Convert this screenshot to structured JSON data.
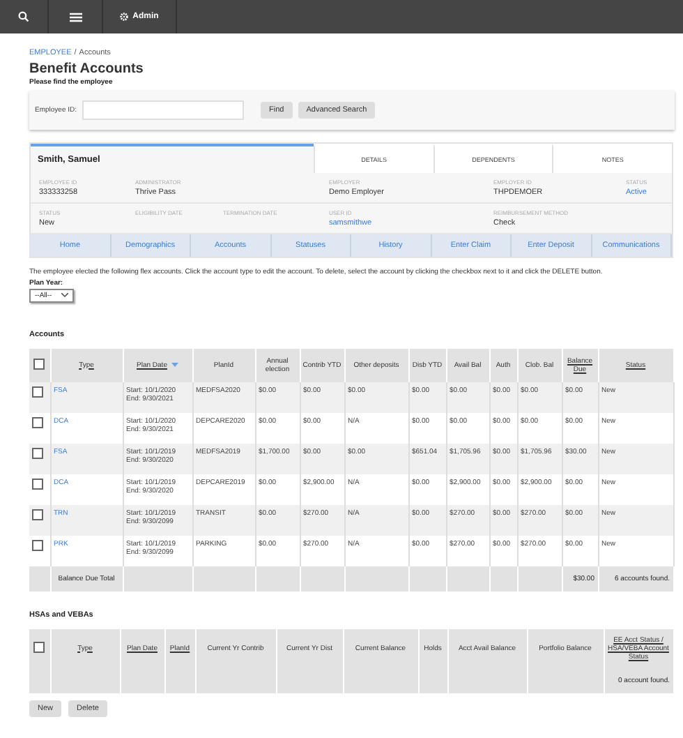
{
  "topbar": {
    "admin_label": "Admin"
  },
  "breadcrumb": {
    "link": "EMPLOYEE",
    "separator": "/",
    "current": "Accounts"
  },
  "title": "Benefit Accounts",
  "subtitle": "Please find the employee",
  "search": {
    "label": "Employee ID:",
    "buttons": [
      "Find",
      "Advanced Search"
    ]
  },
  "employee": {
    "name": "Smith, Samuel",
    "tabs": [
      {
        "label": "DETAILS",
        "selected": false
      },
      {
        "label": "DEPENDENTS",
        "selected": false
      },
      {
        "label": "NOTES",
        "selected": false
      }
    ],
    "fields_row_1": [
      {
        "label": "EMPLOYEE ID",
        "value": "333333258",
        "link": false
      },
      {
        "label": "ADMINISTRATOR",
        "value": "Thrive Pass",
        "link": false
      },
      {
        "label": "EMPLOYER",
        "value": "Demo Employer",
        "link": false
      },
      {
        "label": "EMPLOYER ID",
        "value": "THPDEMOER",
        "link": false
      },
      {
        "label": "STATUS",
        "value": "Active",
        "link": true
      }
    ],
    "fields_row_2": [
      {
        "label": "STATUS",
        "value": "New",
        "link": false
      },
      {
        "label": "ELIGIBILITY DATE"
      },
      {
        "label": "TERMINATION DATE"
      },
      {
        "label": "USER ID",
        "value": "samsmithwe",
        "link": true
      },
      {
        "label": "REIMBURSEMENT METHOD",
        "value": "Check",
        "link": false
      }
    ],
    "nav": [
      {
        "label": "Home",
        "selected": false
      },
      {
        "label": "Demographics",
        "selected": false
      },
      {
        "label": "Accounts",
        "selected": false
      },
      {
        "label": "Statuses",
        "selected": false
      },
      {
        "label": "History",
        "selected": false
      },
      {
        "label": "Enter Claim",
        "selected": false
      },
      {
        "label": "Enter Deposit",
        "selected": false
      },
      {
        "label": "Communications",
        "selected": false
      }
    ]
  },
  "instructions": "The employee elected the following flex accounts. Click the account type to edit the account. To delete, select the account by clicking the checkbox next to it and click the DELETE button.",
  "plan_year": {
    "label": "Plan Year:",
    "value": "--All--"
  },
  "accounts": {
    "title": "Accounts",
    "header_checked": false,
    "columns": [
      {
        "label": "Type",
        "link": true
      },
      {
        "label": "Plan Date",
        "link": true,
        "sorted": true
      },
      {
        "label": "PlanId",
        "link": false
      },
      {
        "label": "Annual election",
        "link": false
      },
      {
        "label": "Contrib YTD",
        "link": false
      },
      {
        "label": "Other deposits",
        "link": false
      },
      {
        "label": "Disb YTD",
        "link": false
      },
      {
        "label": "Avail Bal",
        "link": false
      },
      {
        "label": "Auth",
        "link": false
      },
      {
        "label": "Clob. Bal",
        "link": false
      },
      {
        "label": "Balance Due",
        "link": true
      },
      {
        "label": "Status",
        "link": true
      }
    ],
    "rows": [
      {
        "checked": false,
        "cells": [
          "FSA",
          "Start: 10/1/2020\nEnd: 9/30/2021",
          "MEDFSA2020",
          "$0.00",
          "$0.00",
          "$0.00",
          "$0.00",
          "$0.00",
          "$0.00",
          "$0.00",
          "$0.00",
          "New"
        ]
      },
      {
        "checked": false,
        "cells": [
          "DCA",
          "Start: 10/1/2020\nEnd: 9/30/2021",
          "DEPCARE2020",
          "$0.00",
          "$0.00",
          "N/A",
          "$0.00",
          "$0.00",
          "$0.00",
          "$0.00",
          "$0.00",
          "New"
        ]
      },
      {
        "checked": false,
        "cells": [
          "FSA",
          "Start: 10/1/2019\nEnd: 9/30/2020",
          "MEDFSA2019",
          "$1,700.00",
          "$0.00",
          "$0.00",
          "$651.04",
          "$1,705.96",
          "$0.00",
          "$1,705.96",
          "$30.00",
          "New"
        ]
      },
      {
        "checked": false,
        "cells": [
          "DCA",
          "Start: 10/1/2019\nEnd: 9/30/2020",
          "DEPCARE2019",
          "$0.00",
          "$2,900.00",
          "N/A",
          "$0.00",
          "$2,900.00",
          "$0.00",
          "$2,900.00",
          "$0.00",
          "New"
        ]
      },
      {
        "checked": false,
        "cells": [
          "TRN",
          "Start: 10/1/2019\nEnd: 9/30/2099",
          "TRANSIT",
          "$0.00",
          "$270.00",
          "N/A",
          "$0.00",
          "$270.00",
          "$0.00",
          "$270.00",
          "$0.00",
          "New"
        ]
      },
      {
        "checked": false,
        "cells": [
          "PRK",
          "Start: 10/1/2019\nEnd: 9/30/2099",
          "PARKING",
          "$0.00",
          "$270.00",
          "N/A",
          "$0.00",
          "$270.00",
          "$0.00",
          "$270.00",
          "$0.00",
          "New"
        ]
      }
    ],
    "footer": {
      "label": "Balance Due Total",
      "total": "$30.00",
      "count": "6 accounts found."
    }
  },
  "hsas": {
    "title": "HSAs and VEBAs",
    "header_checked": false,
    "columns": [
      {
        "label": "Type",
        "link": true
      },
      {
        "label": "Plan Date",
        "link": true
      },
      {
        "label": "PlanId",
        "link": true
      },
      {
        "label": "Current Yr Contrib",
        "link": false
      },
      {
        "label": "Current Yr Dist",
        "link": false
      },
      {
        "label": "Current Balance",
        "link": false
      },
      {
        "label": "Holds",
        "link": false
      },
      {
        "label": "Acct Avail Balance",
        "link": false
      },
      {
        "label": "Portfolio Balance",
        "link": false
      },
      {
        "label": "EE Acct Status / HSA/VEBA Account Status",
        "link": true
      }
    ],
    "footer": {
      "count": "0 account found."
    }
  },
  "buttons": [
    "New",
    "Delete"
  ]
}
